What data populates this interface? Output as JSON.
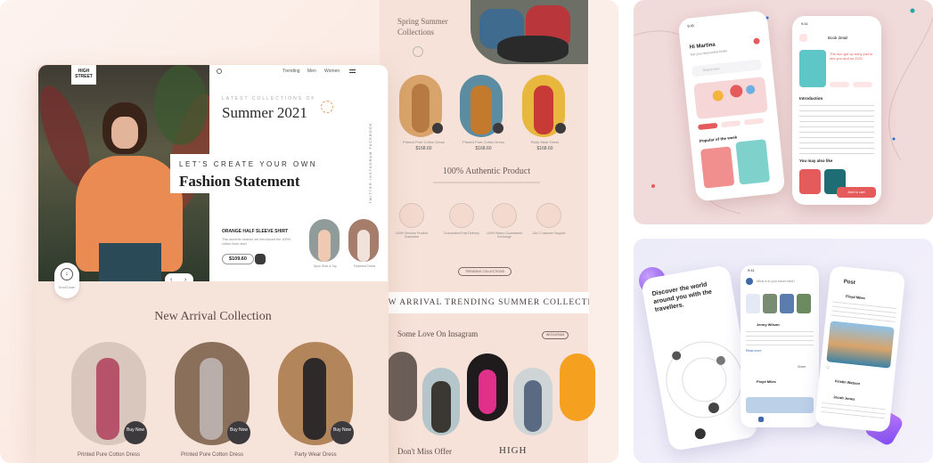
{
  "mockup": {
    "brand": "HIGH\nSTREET",
    "nav": [
      "Trending",
      "Men",
      "Women"
    ],
    "hero_kicker": "LATEST COLLECTIONS OF",
    "hero_title": "Summer 2021",
    "tagline_1": "LET'S CREATE YOUR OWN",
    "tagline_2": "Fashion Statement",
    "social": "TWITTER  INSTAGRAM  FACEBOOK",
    "product_title": "ORANGE HALF SLEEVE SHIRT",
    "product_desc": "This summer season we introduced the 100% cotton linen shirt",
    "product_price": "$109.60",
    "thumb_1": "Spun Shirt & Top",
    "thumb_2": "Flowered Dress",
    "scroll_label": "Scroll Down",
    "new_arrival_title": "New Arrival Collection",
    "new_arrivals": [
      {
        "name": "Printed Pure Cotton Dress",
        "btn": "Buy Now"
      },
      {
        "name": "Printed Pure Cotton Dress",
        "btn": "Buy Now"
      },
      {
        "name": "Party Wear Dress",
        "btn": "Buy Now"
      }
    ],
    "spring_title": "Spring Summer Collections",
    "spring_items": [
      {
        "name": "Printed Pure Cotton Dress",
        "price": "$168.60"
      },
      {
        "name": "Printed Pure Cotton Dress",
        "price": "$168.60"
      },
      {
        "name": "Party Wear Dress",
        "price": "$168.60"
      }
    ],
    "authentic_title": "100% Authentic Product",
    "features": [
      "100% Genuine Product Guarantee",
      "Guaranteed Fast Delivery",
      "100% Return Guaranteed Exchange",
      "24x7 Customer Support"
    ],
    "trending_btn": "TRENDING COLLECTIONS",
    "marquee": "NEW ARRIVAL  TRENDING  SUMMER COLLECTIONS",
    "instagram_title": "Some Love On Insagram",
    "instagram_btn": "INSTAGRAM",
    "offer_title": "Don't Miss Offer",
    "offer_brand": "HIGH"
  },
  "book_app": {
    "greeting": "Hi Martina",
    "sub": "Get your discounted books",
    "search_placeholder": "Search here",
    "popular": "Popular of the week",
    "see_all": "See all",
    "detail_title": "Book detail",
    "book_name": "The sun got up early just to see you and us 2021",
    "intro": "Introduction",
    "you_may_like": "You may also like",
    "add_btn": "Add to cart",
    "status_time": "9:41"
  },
  "travel_app": {
    "hero": "Discover the world around you with the travellers.",
    "search": "What is in your travel mind?",
    "post_title": "Post",
    "status_time": "9:41",
    "user_1": "Jenny Wilson",
    "user_2": "Floyd Miles",
    "user_3": "Kristin Watson",
    "user_4": "Jacob Jones",
    "share": "Share",
    "read_more": "Read more"
  },
  "colors": {
    "peach": "#f7e4dc",
    "orange_shirt": "#e98b53",
    "dark_btn": "#3d3a3d",
    "book_red": "#e55a5a",
    "teal": "#1ea6a1",
    "lavender": "#ecebf8"
  },
  "icons": [
    "search-icon",
    "menu-icon",
    "arrow-down-icon",
    "chevron-left-icon",
    "chevron-right-icon",
    "cart-icon",
    "bell-icon",
    "heart-icon",
    "share-icon",
    "home-icon",
    "plus-icon"
  ]
}
